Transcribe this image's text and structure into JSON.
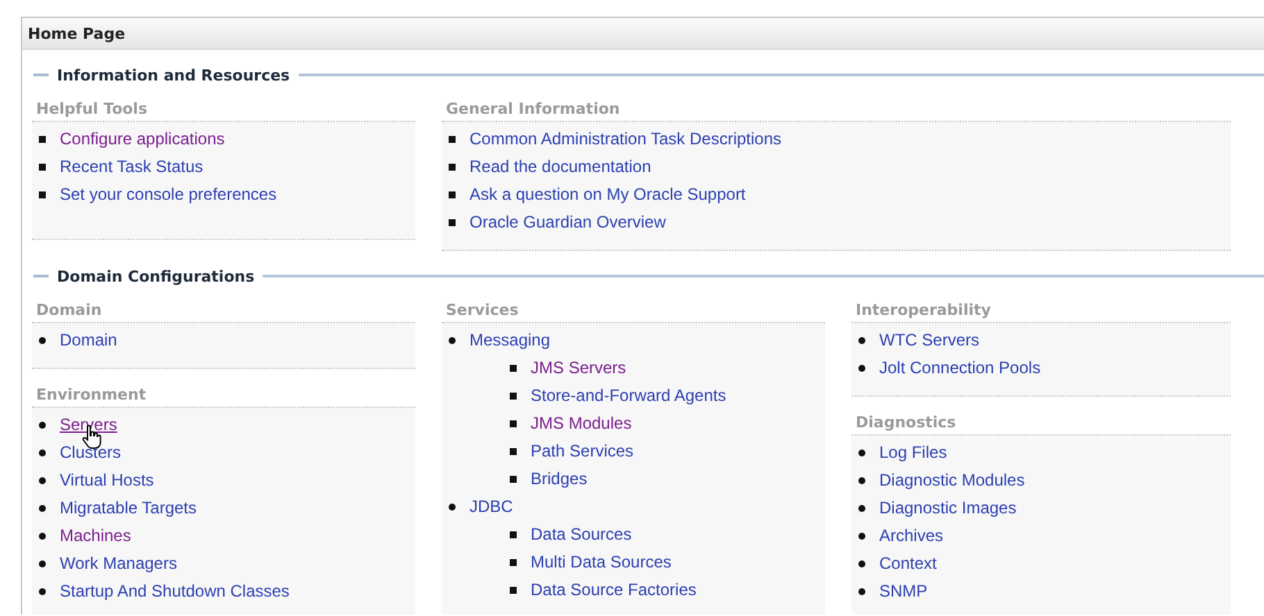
{
  "page_title": "Home Page",
  "sections": [
    {
      "title": "Information and Resources",
      "columns": [
        [
          {
            "heading": "Helpful Tools",
            "items": [
              {
                "label": "Configure applications",
                "visited": true,
                "hovered": false
              },
              {
                "label": "Recent Task Status",
                "visited": false,
                "hovered": false
              },
              {
                "label": "Set your console preferences",
                "visited": false,
                "hovered": false
              }
            ]
          }
        ],
        [
          {
            "heading": "General Information",
            "items": [
              {
                "label": "Common Administration Task Descriptions",
                "visited": false,
                "hovered": false
              },
              {
                "label": "Read the documentation",
                "visited": false,
                "hovered": false
              },
              {
                "label": "Ask a question on My Oracle Support",
                "visited": false,
                "hovered": false
              },
              {
                "label": "Oracle Guardian Overview",
                "visited": false,
                "hovered": false
              }
            ]
          }
        ]
      ]
    },
    {
      "title": "Domain Configurations",
      "columns": [
        [
          {
            "heading": "Domain",
            "items": [
              {
                "label": "Domain",
                "visited": false,
                "hovered": false
              }
            ]
          },
          {
            "heading": "Environment",
            "items": [
              {
                "label": "Servers",
                "visited": true,
                "hovered": true
              },
              {
                "label": "Clusters",
                "visited": false,
                "hovered": false
              },
              {
                "label": "Virtual Hosts",
                "visited": false,
                "hovered": false
              },
              {
                "label": "Migratable Targets",
                "visited": false,
                "hovered": false
              },
              {
                "label": "Machines",
                "visited": true,
                "hovered": false
              },
              {
                "label": "Work Managers",
                "visited": false,
                "hovered": false
              },
              {
                "label": "Startup And Shutdown Classes",
                "visited": false,
                "hovered": false
              }
            ]
          }
        ],
        [
          {
            "heading": "Services",
            "items": [
              {
                "label": "Messaging",
                "visited": false,
                "hovered": false,
                "children": [
                  {
                    "label": "JMS Servers",
                    "visited": true,
                    "hovered": false
                  },
                  {
                    "label": "Store-and-Forward Agents",
                    "visited": false,
                    "hovered": false
                  },
                  {
                    "label": "JMS Modules",
                    "visited": true,
                    "hovered": false
                  },
                  {
                    "label": "Path Services",
                    "visited": false,
                    "hovered": false
                  },
                  {
                    "label": "Bridges",
                    "visited": false,
                    "hovered": false
                  }
                ]
              },
              {
                "label": "JDBC",
                "visited": false,
                "hovered": false,
                "children": [
                  {
                    "label": "Data Sources",
                    "visited": false,
                    "hovered": false
                  },
                  {
                    "label": "Multi Data Sources",
                    "visited": false,
                    "hovered": false
                  },
                  {
                    "label": "Data Source Factories",
                    "visited": false,
                    "hovered": false
                  }
                ]
              }
            ]
          }
        ],
        [
          {
            "heading": "Interoperability",
            "items": [
              {
                "label": "WTC Servers",
                "visited": false,
                "hovered": false
              },
              {
                "label": "Jolt Connection Pools",
                "visited": false,
                "hovered": false
              }
            ]
          },
          {
            "heading": "Diagnostics",
            "items": [
              {
                "label": "Log Files",
                "visited": false,
                "hovered": false
              },
              {
                "label": "Diagnostic Modules",
                "visited": false,
                "hovered": false
              },
              {
                "label": "Diagnostic Images",
                "visited": false,
                "hovered": false
              },
              {
                "label": "Archives",
                "visited": false,
                "hovered": false
              },
              {
                "label": "Context",
                "visited": false,
                "hovered": false
              },
              {
                "label": "SNMP",
                "visited": false,
                "hovered": false
              }
            ]
          }
        ]
      ]
    }
  ]
}
